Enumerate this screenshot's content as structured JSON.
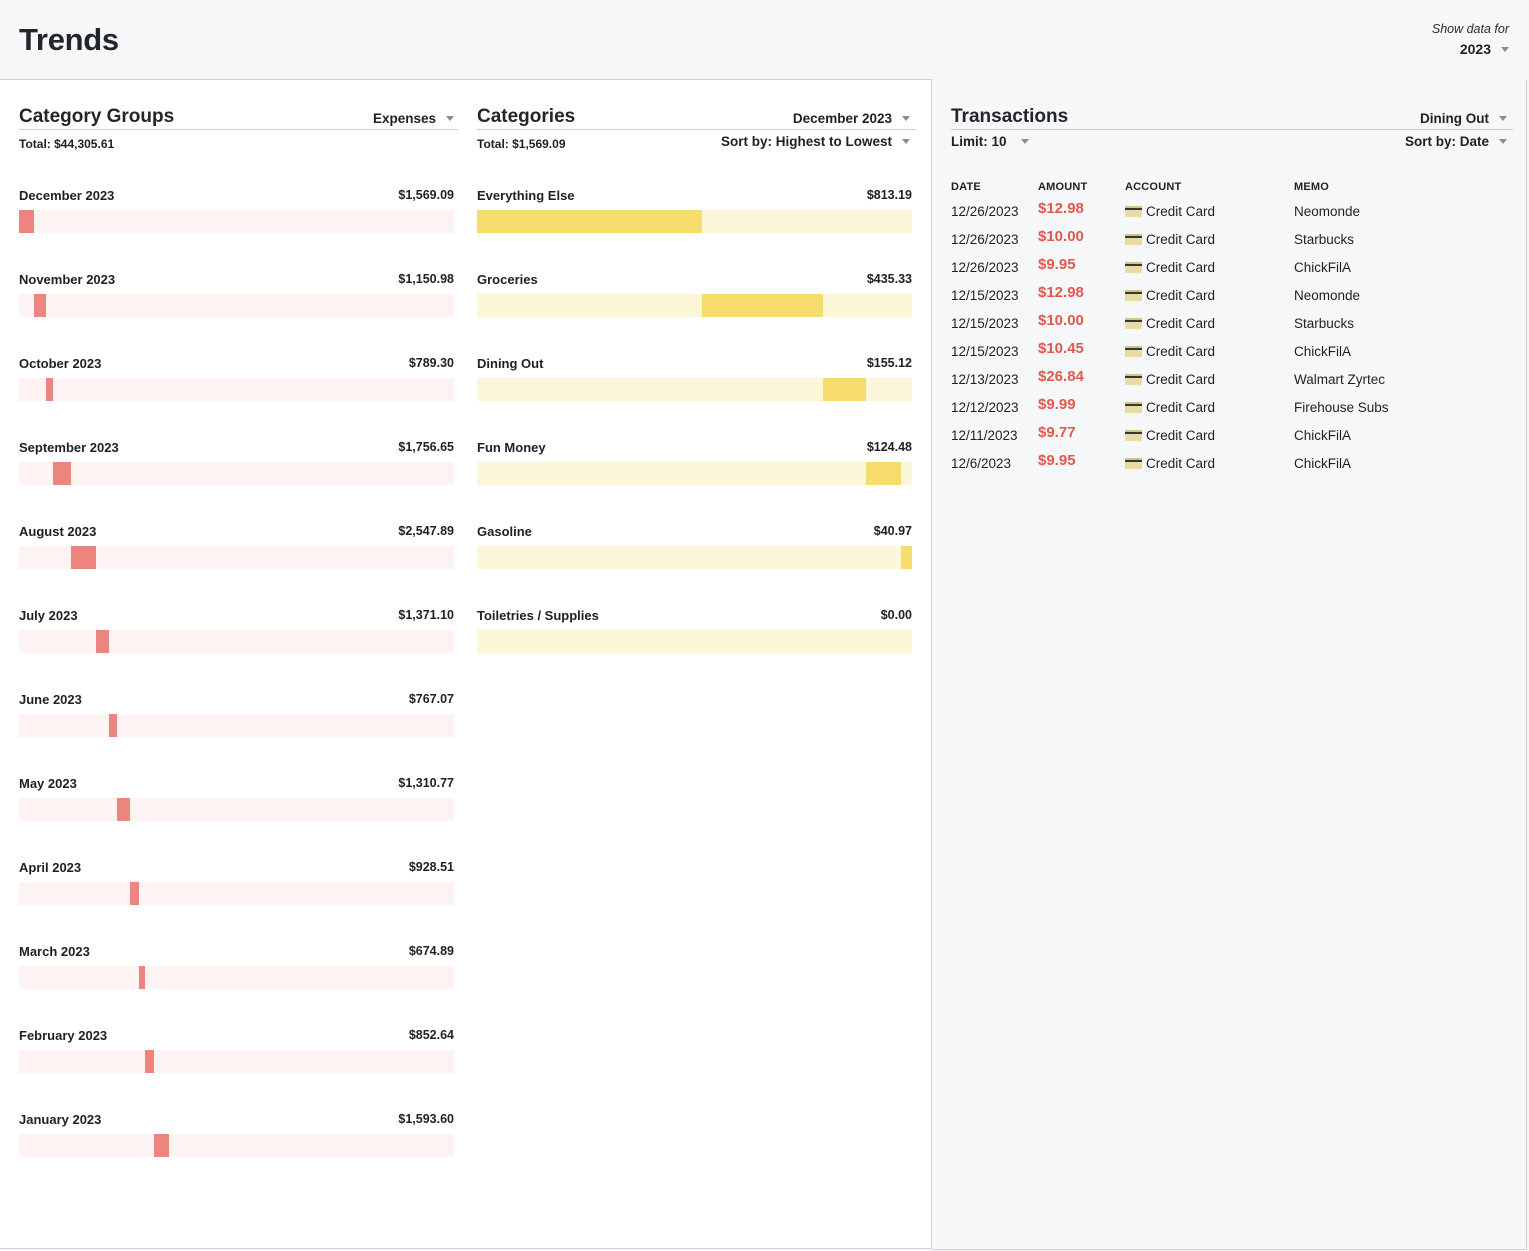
{
  "header": {
    "title": "Trends",
    "show_data_label": "Show data for",
    "year": "2023"
  },
  "category_groups": {
    "title": "Category Groups",
    "filter": "Expenses",
    "total": "Total: $44,305.61"
  },
  "categories": {
    "title": "Categories",
    "month": "December 2023",
    "sort": "Sort by: Highest to Lowest",
    "total": "Total: $1,569.09"
  },
  "transactions": {
    "title": "Transactions",
    "category": "Dining Out",
    "limit": "Limit: 10",
    "sort": "Sort by: Date",
    "columns": [
      "DATE",
      "AMOUNT",
      "ACCOUNT",
      "MEMO"
    ],
    "rows": [
      {
        "date": "12/26/2023",
        "amount": "$12.98",
        "account": "Credit Card",
        "memo": "Neomonde"
      },
      {
        "date": "12/26/2023",
        "amount": "$10.00",
        "account": "Credit Card",
        "memo": "Starbucks"
      },
      {
        "date": "12/26/2023",
        "amount": "$9.95",
        "account": "Credit Card",
        "memo": "ChickFilA"
      },
      {
        "date": "12/15/2023",
        "amount": "$12.98",
        "account": "Credit Card",
        "memo": "Neomonde"
      },
      {
        "date": "12/15/2023",
        "amount": "$10.00",
        "account": "Credit Card",
        "memo": "Starbucks"
      },
      {
        "date": "12/15/2023",
        "amount": "$10.45",
        "account": "Credit Card",
        "memo": "ChickFilA"
      },
      {
        "date": "12/13/2023",
        "amount": "$26.84",
        "account": "Credit Card",
        "memo": "Walmart Zyrtec"
      },
      {
        "date": "12/12/2023",
        "amount": "$9.99",
        "account": "Credit Card",
        "memo": "Firehouse Subs"
      },
      {
        "date": "12/11/2023",
        "amount": "$9.77",
        "account": "Credit Card",
        "memo": "ChickFilA"
      },
      {
        "date": "12/6/2023",
        "amount": "$9.95",
        "account": "Credit Card",
        "memo": "ChickFilA"
      }
    ]
  },
  "colors": {
    "group_bar": "#ec857d",
    "group_track": "#fdf3f2",
    "category_bar": "#f6dd6b",
    "category_track": "#fcf7d8",
    "amount_red": "#e05a4e"
  },
  "chart_data": [
    {
      "type": "bar",
      "title": "Category Groups",
      "style": "cumulative-segment",
      "total": 44305.61,
      "categories": [
        "December 2023",
        "November 2023",
        "October 2023",
        "September 2023",
        "August 2023",
        "July 2023",
        "June 2023",
        "May 2023",
        "April 2023",
        "March 2023",
        "February 2023",
        "January 2023"
      ],
      "labels": [
        "$1,569.09",
        "$1,150.98",
        "$789.30",
        "$1,756.65",
        "$2,547.89",
        "$1,371.10",
        "$767.07",
        "$1,310.77",
        "$928.51",
        "$674.89",
        "$852.64",
        "$1,593.60"
      ],
      "values": [
        1569.09,
        1150.98,
        789.3,
        1756.65,
        2547.89,
        1371.1,
        767.07,
        1310.77,
        928.51,
        674.89,
        852.64,
        1593.6
      ]
    },
    {
      "type": "bar",
      "title": "Categories",
      "style": "cumulative-segment",
      "total": 1569.09,
      "categories": [
        "Everything Else",
        "Groceries",
        "Dining Out",
        "Fun Money",
        "Gasoline",
        "Toiletries / Supplies"
      ],
      "labels": [
        "$813.19",
        "$435.33",
        "$155.12",
        "$124.48",
        "$40.97",
        "$0.00"
      ],
      "values": [
        813.19,
        435.33,
        155.12,
        124.48,
        40.97,
        0.0
      ]
    }
  ]
}
